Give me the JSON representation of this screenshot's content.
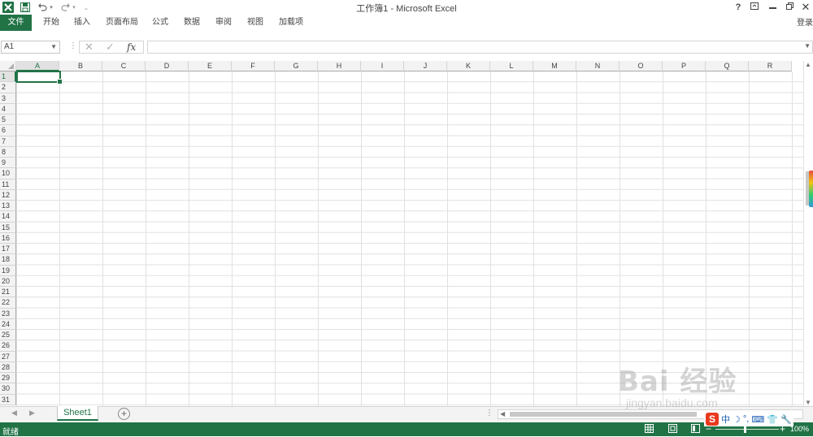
{
  "window": {
    "title": "工作簿1 - Microsoft Excel",
    "help": "?",
    "login": "登录"
  },
  "ribbon": {
    "tabs": [
      "文件",
      "开始",
      "插入",
      "页面布局",
      "公式",
      "数据",
      "审阅",
      "视图",
      "加载项"
    ]
  },
  "formula_bar": {
    "name_box": "A1",
    "fx": "fx",
    "value": ""
  },
  "grid": {
    "columns": [
      "A",
      "B",
      "C",
      "D",
      "E",
      "F",
      "G",
      "H",
      "I",
      "J",
      "K",
      "L",
      "M",
      "N",
      "O",
      "P",
      "Q",
      "R"
    ],
    "rows": [
      "1",
      "2",
      "3",
      "4",
      "5",
      "6",
      "7",
      "8",
      "9",
      "10",
      "11",
      "12",
      "13",
      "14",
      "15",
      "16",
      "17",
      "18",
      "19",
      "20",
      "21",
      "22",
      "23",
      "24",
      "25",
      "26",
      "27",
      "28",
      "29",
      "30",
      "31"
    ],
    "selected_cell": "A1"
  },
  "sheets": {
    "tabs": [
      "Sheet1"
    ],
    "active": "Sheet1"
  },
  "status": {
    "ready": "就绪",
    "zoom": "100%"
  },
  "ime": {
    "logo": "S",
    "mode": "中"
  },
  "watermark": {
    "logo": "Bai 经验",
    "url": "jingyan.baidu.com"
  },
  "colors": {
    "accent": "#217346"
  }
}
